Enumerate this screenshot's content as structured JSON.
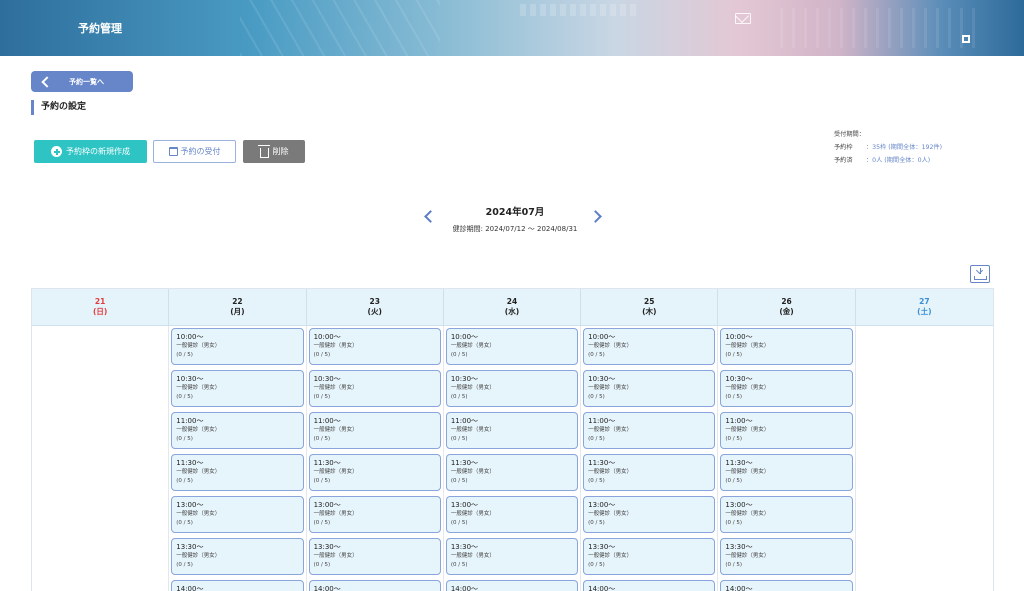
{
  "header": {
    "title": "予約管理"
  },
  "back_button": {
    "label": "予約一覧へ"
  },
  "section_title": "予約の設定",
  "toolbar": {
    "create_label": "予約枠の新規作成",
    "receive_label": "予約の受付",
    "delete_label": "削除"
  },
  "info": {
    "period_label": "受付期間：",
    "slots_key": "予約枠",
    "slots_val": "：35枠 (期間全体：192件)",
    "booked_key": "予約済",
    "booked_val": "：0人 (期間全体：0人)"
  },
  "month_nav": {
    "title": "2024年07月",
    "period": "健診期間: 2024/07/12 ～ 2024/08/31"
  },
  "calendar": {
    "days": [
      {
        "date": "21",
        "dow": "(日)"
      },
      {
        "date": "22",
        "dow": "(月)"
      },
      {
        "date": "23",
        "dow": "(火)"
      },
      {
        "date": "24",
        "dow": "(水)"
      },
      {
        "date": "25",
        "dow": "(木)"
      },
      {
        "date": "26",
        "dow": "(金)"
      },
      {
        "date": "27",
        "dow": "(土)"
      }
    ],
    "slot_type": "一般健診（男女）",
    "slot_capacity": "(0 / 5)",
    "times": [
      "10:00～",
      "10:30～",
      "11:00～",
      "11:30～",
      "13:00～",
      "13:30～",
      "14:00～"
    ]
  },
  "colors": {
    "accent": "#6686c9",
    "create": "#2ec4c4",
    "delete": "#7a7a7a",
    "sunday": "#e43c3c",
    "saturday": "#3a8fd6"
  }
}
